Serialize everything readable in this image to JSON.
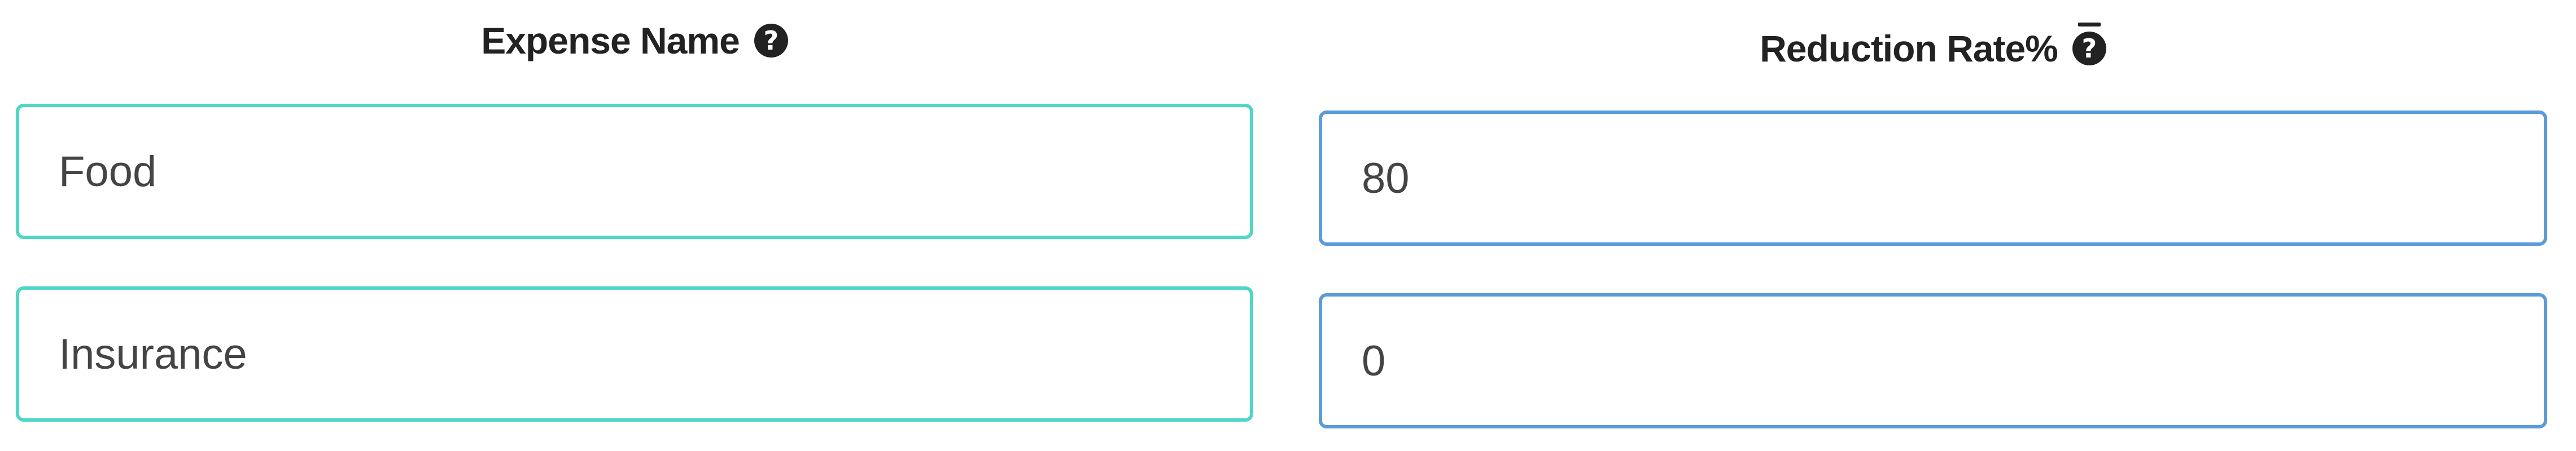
{
  "columns": {
    "expense_name": {
      "header": "Expense Name",
      "help_icon": "question-circle-icon"
    },
    "reduction_rate": {
      "header": "Reduction Rate%",
      "help_icon": "question-circle-icon"
    }
  },
  "rows": [
    {
      "expense_name": "Food",
      "reduction_rate": "80"
    },
    {
      "expense_name": "Insurance",
      "reduction_rate": "0"
    }
  ],
  "colors": {
    "name_field_border": "#4fd6c6",
    "rate_field_border": "#5b9bd8",
    "header_text": "#222222"
  }
}
